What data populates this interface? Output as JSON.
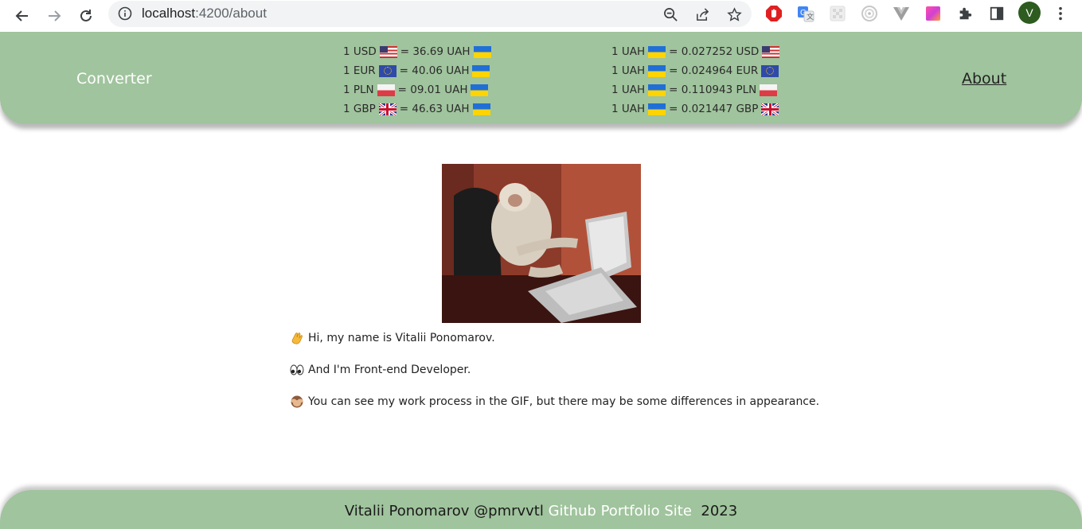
{
  "browser": {
    "url_host": "localhost",
    "url_rest": ":4200/about"
  },
  "header": {
    "brand": "Converter",
    "about_link": "About",
    "rates_to_uah": [
      {
        "lhs": "1 USD",
        "flag": "us-flag",
        "rhs": "= 36.69 UAH"
      },
      {
        "lhs": "1 EUR",
        "flag": "eu-flag",
        "rhs": "= 40.06 UAH"
      },
      {
        "lhs": "1 PLN",
        "flag": "pl-flag",
        "rhs": "= 09.01 UAH"
      },
      {
        "lhs": "1 GBP",
        "flag": "gb-flag",
        "rhs": "= 46.63 UAH"
      }
    ],
    "rates_from_uah": [
      {
        "lhs": "1 UAH",
        "rhs": "= 0.027252 USD",
        "flag": "us-flag"
      },
      {
        "lhs": "1 UAH",
        "rhs": "= 0.024964 EUR",
        "flag": "eu-flag"
      },
      {
        "lhs": "1 UAH",
        "rhs": "= 0.110943 PLN",
        "flag": "pl-flag"
      },
      {
        "lhs": "1 UAH",
        "rhs": "= 0.021447 GBP",
        "flag": "gb-flag"
      }
    ]
  },
  "main": {
    "intro": "Hi, my name is Vitalii Ponomarov.",
    "role": "And I'm Front-end Developer.",
    "gif_note": "You can see my work process in the GIF, but there may be some differences in appearance."
  },
  "footer": {
    "author": "Vitalii Ponomarov @pmrvvtl",
    "link_github": "Github",
    "link_portfolio": "Portfolio Site",
    "year": "2023"
  },
  "avatar_letter": "V"
}
